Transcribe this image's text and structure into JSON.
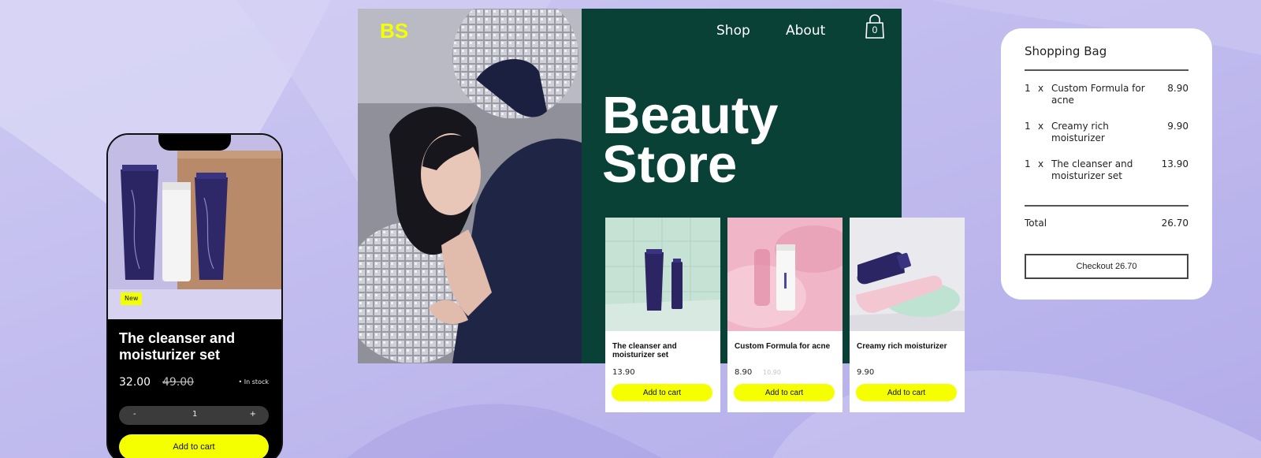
{
  "phone": {
    "badge": "New",
    "product_title": "The cleanser and moisturizer set",
    "price": "32.00",
    "old_price": "49.00",
    "stock": "• In stock",
    "stepper": {
      "minus": "-",
      "qty": "1",
      "plus": "+"
    },
    "add_to_cart": "Add to cart"
  },
  "site": {
    "logo": "BS",
    "nav": {
      "shop": "Shop",
      "about": "About"
    },
    "bag_count": "0",
    "hero_line1": "Beauty",
    "hero_line2": "Store",
    "products": [
      {
        "name": "The cleanser and moisturizer set",
        "price": "13.90",
        "old_price": "",
        "button": "Add to cart"
      },
      {
        "name": "Custom Formula for acne",
        "price": "8.90",
        "old_price": "10.90",
        "button": "Add to cart"
      },
      {
        "name": "Creamy rich moisturizer",
        "price": "9.90",
        "old_price": "",
        "button": "Add to cart"
      }
    ]
  },
  "bag": {
    "title": "Shopping Bag",
    "items": [
      {
        "qty": "1",
        "x": "x",
        "name": "Custom Formula for acne",
        "price": "8.90"
      },
      {
        "qty": "1",
        "x": "x",
        "name": "Creamy rich moisturizer",
        "price": "9.90"
      },
      {
        "qty": "1",
        "x": "x",
        "name": "The cleanser and moisturizer set",
        "price": "13.90"
      }
    ],
    "total_label": "Total",
    "total_value": "26.70",
    "checkout": "Checkout 26.70"
  },
  "colors": {
    "background": "#bdb7ea",
    "brand_green": "#0a4136",
    "accent_yellow": "#f5ff00",
    "product_purple": "#2b2563"
  },
  "icons": [
    "shopping-bag-icon"
  ]
}
